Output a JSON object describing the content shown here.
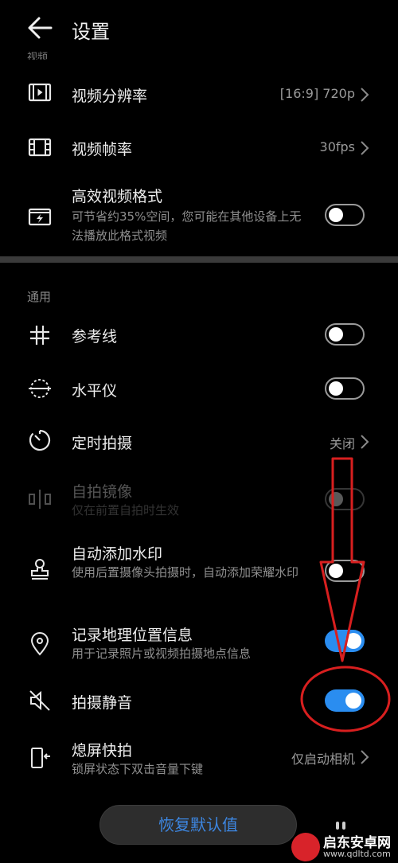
{
  "header": {
    "title": "设置",
    "cut_section": "视频"
  },
  "video": {
    "resolution": {
      "label": "视频分辨率",
      "value": "[16:9] 720p"
    },
    "framerate": {
      "label": "视频帧率",
      "value": "30fps"
    },
    "hevc": {
      "label": "高效视频格式",
      "desc": "可节省约35%空间，您可能在其他设备上无法播放此格式视频",
      "enabled": false
    }
  },
  "general": {
    "section_title": "通用",
    "grid": {
      "label": "参考线",
      "enabled": false
    },
    "level": {
      "label": "水平仪",
      "enabled": false
    },
    "timer": {
      "label": "定时拍摄",
      "value": "关闭"
    },
    "mirror": {
      "label": "自拍镜像",
      "desc": "仅在前置自拍时生效",
      "enabled": false,
      "disabled": true
    },
    "watermark": {
      "label": "自动添加水印",
      "desc": "使用后置摄像头拍摄时，自动添加荣耀水印",
      "enabled": false
    },
    "location": {
      "label": "记录地理位置信息",
      "desc": "用于记录照片或视频拍摄地点信息",
      "enabled": true
    },
    "mute": {
      "label": "拍摄静音",
      "enabled": true
    },
    "quick_snap": {
      "label": "熄屏快拍",
      "desc": "锁屏状态下双击音量下键",
      "value": "仅启动相机"
    }
  },
  "footer": {
    "restore_label": "恢复默认值"
  },
  "watermark_brand": {
    "name": "启东安卓网",
    "url": "www.qdltd.com"
  },
  "colors": {
    "accent": "#2a8df0",
    "annotation": "#d81f1f",
    "restore_text": "#3d86e0"
  }
}
